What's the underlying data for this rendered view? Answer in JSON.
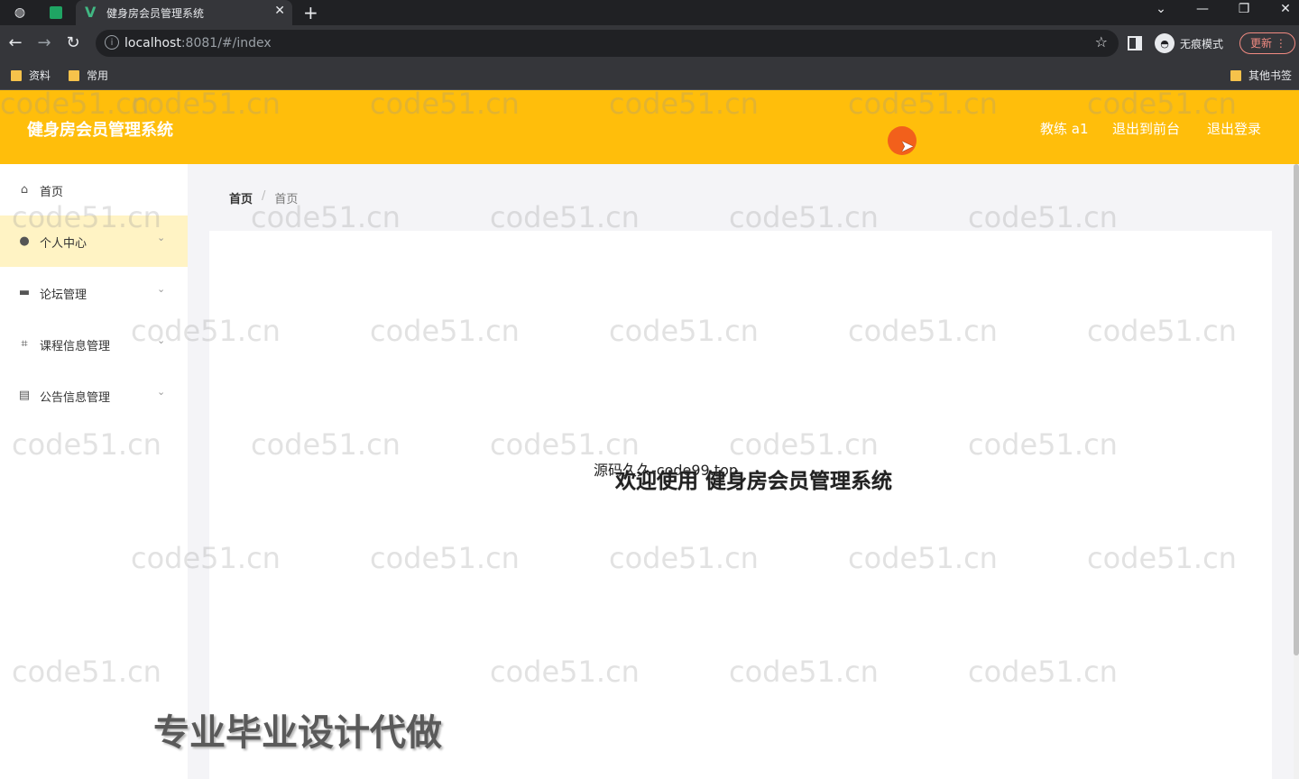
{
  "browser": {
    "tab_title": "健身房会员管理系统",
    "url_host": "localhost",
    "url_rest": ":8081/#/index",
    "incognito_label": "无痕模式",
    "update_label": "更新",
    "bookmarks": [
      "资料",
      "常用"
    ],
    "other_bookmarks": "其他书签"
  },
  "header": {
    "title": "健身房会员管理系统",
    "user": "教练 a1",
    "to_front": "退出到前台",
    "logout": "退出登录"
  },
  "sidebar": {
    "items": [
      {
        "label": "首页",
        "icon": "home-icon"
      },
      {
        "label": "个人中心",
        "icon": "user-icon"
      },
      {
        "label": "论坛管理",
        "icon": "briefcase-icon"
      },
      {
        "label": "课程信息管理",
        "icon": "crop-icon"
      },
      {
        "label": "公告信息管理",
        "icon": "clipboard-icon"
      }
    ]
  },
  "breadcrumb": {
    "home": "首页",
    "sep": "/",
    "current": "首页"
  },
  "main": {
    "welcome": "欢迎使用 健身房会员管理系统",
    "overlay_source": "源码久久-code99.top",
    "promo": "专业毕业设计代做"
  },
  "watermark": "code51.cn",
  "colors": {
    "accent": "#ffbe0b",
    "active_menu": "#fff3c4"
  }
}
